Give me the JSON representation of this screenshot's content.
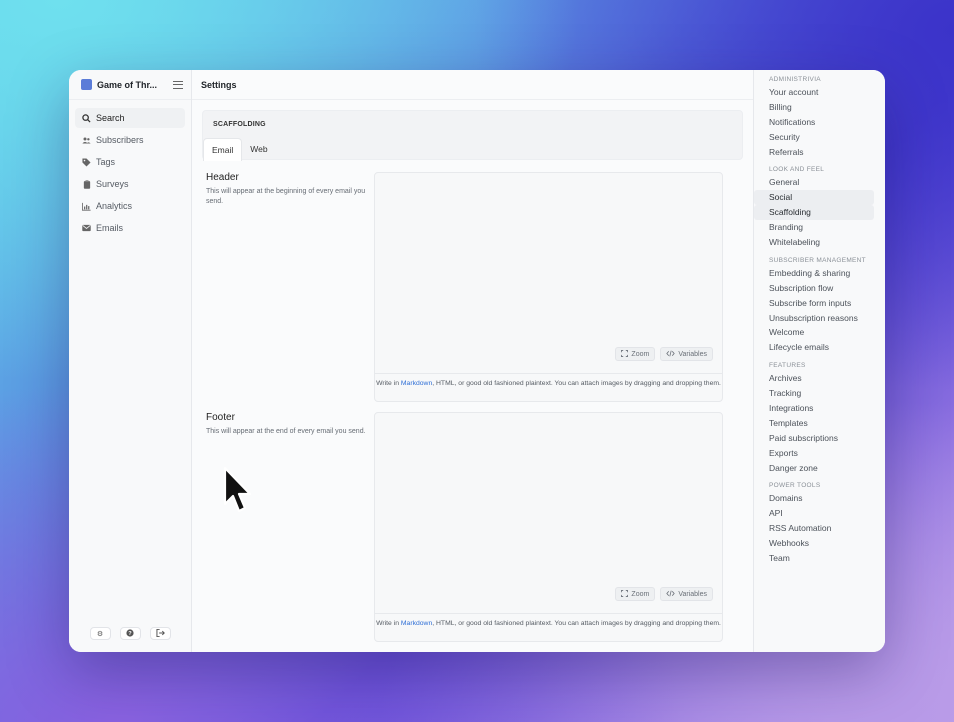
{
  "app": {
    "name": "Game of Thr..."
  },
  "sidebar": {
    "items": [
      {
        "label": "Search",
        "icon": "search-icon"
      },
      {
        "label": "Subscribers",
        "icon": "users-icon"
      },
      {
        "label": "Tags",
        "icon": "tag-icon"
      },
      {
        "label": "Surveys",
        "icon": "clipboard-icon"
      },
      {
        "label": "Analytics",
        "icon": "chart-icon"
      },
      {
        "label": "Emails",
        "icon": "mail-icon"
      }
    ],
    "footer": [
      "gear-icon",
      "help-icon",
      "logout-icon"
    ]
  },
  "header": {
    "title": "Settings"
  },
  "section": {
    "title": "SCAFFOLDING",
    "tabs": [
      "Email",
      "Web"
    ],
    "active_tab": "Email"
  },
  "fields": {
    "header": {
      "label": "Header",
      "description": "This will appear at the beginning of every email you send."
    },
    "footer": {
      "label": "Footer",
      "description": "This will appear at the end of every email you send."
    },
    "zoom_label": "Zoom",
    "variables_label": "Variables",
    "hint_prefix": "Write in ",
    "hint_link": "Markdown",
    "hint_suffix": ", HTML, or good old fashioned plaintext. You can attach images by dragging and dropping them."
  },
  "settings_nav": {
    "groups": [
      {
        "label": "ADMINISTRIVIA",
        "items": [
          "Your account",
          "Billing",
          "Notifications",
          "Security",
          "Referrals"
        ]
      },
      {
        "label": "LOOK AND FEEL",
        "items": [
          "General",
          "Social",
          "Scaffolding",
          "Branding",
          "Whitelabeling"
        ]
      },
      {
        "label": "SUBSCRIBER MANAGEMENT",
        "items": [
          "Embedding & sharing",
          "Subscription flow",
          "Subscribe form inputs",
          "Unsubscription reasons",
          "Welcome",
          "Lifecycle emails"
        ]
      },
      {
        "label": "FEATURES",
        "items": [
          "Archives",
          "Tracking",
          "Integrations",
          "Templates",
          "Paid subscriptions",
          "Exports",
          "Danger zone"
        ]
      },
      {
        "label": "POWER TOOLS",
        "items": [
          "Domains",
          "API",
          "RSS Automation",
          "Webhooks",
          "Team"
        ]
      }
    ],
    "active_items": [
      "Social",
      "Scaffolding"
    ]
  },
  "colors": {
    "accent": "#2f6fd6",
    "brand": "#5b7cd8"
  }
}
